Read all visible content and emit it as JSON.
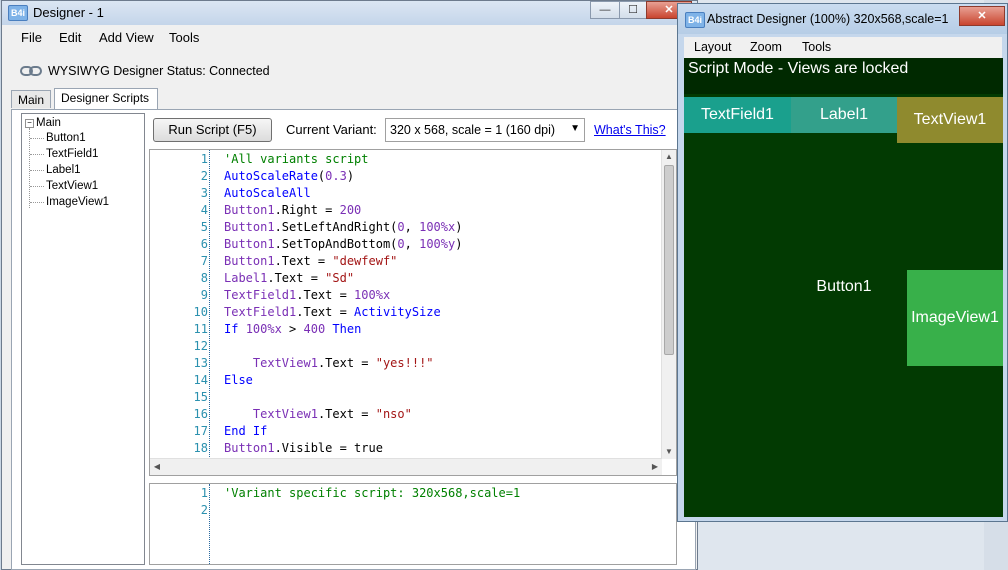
{
  "designer": {
    "title": "Designer - 1",
    "icon_text": "B4i",
    "window_buttons": [
      "—",
      "☐",
      "✕"
    ],
    "menu": [
      {
        "label": "File",
        "accel": "F"
      },
      {
        "label": "Edit",
        "accel": "E"
      },
      {
        "label": "Add View",
        "accel": "A"
      },
      {
        "label": "Tools",
        "accel": "T"
      }
    ],
    "status": "WYSIWYG Designer Status: Connected",
    "status_icon": "link-icon",
    "tabs": [
      "Main",
      "Designer Scripts"
    ],
    "active_tab": "Designer Scripts",
    "tree": {
      "root": "Main",
      "children": [
        "Button1",
        "TextField1",
        "Label1",
        "TextView1",
        "ImageView1"
      ]
    },
    "run_button": "Run Script  (F5)",
    "variant_label": "Current Variant:",
    "variant_value": "320 x 568, scale = 1 (160 dpi)",
    "whats_this": "What's This?",
    "general_script": [
      {
        "n": "1",
        "text": "'All variants script"
      },
      {
        "n": "2",
        "text": "AutoScaleRate(0.3)"
      },
      {
        "n": "3",
        "text": "AutoScaleAll"
      },
      {
        "n": "4",
        "text": "Button1.Right = 200"
      },
      {
        "n": "5",
        "text": "Button1.SetLeftAndRight(0, 100%x)"
      },
      {
        "n": "6",
        "text": "Button1.SetTopAndBottom(0, 100%y)"
      },
      {
        "n": "7",
        "text": "Button1.Text = \"dewfewf\""
      },
      {
        "n": "8",
        "text": "Label1.Text = \"Sd\""
      },
      {
        "n": "9",
        "text": "TextField1.Text = 100%x"
      },
      {
        "n": "10",
        "text": "TextField1.Text = ActivitySize"
      },
      {
        "n": "11",
        "text": "If 100%x > 400 Then"
      },
      {
        "n": "12",
        "text": ""
      },
      {
        "n": "13",
        "text": "    TextView1.Text = \"yes!!!\""
      },
      {
        "n": "14",
        "text": "Else"
      },
      {
        "n": "15",
        "text": ""
      },
      {
        "n": "16",
        "text": "    TextView1.Text = \"nso\""
      },
      {
        "n": "17",
        "text": "End If"
      },
      {
        "n": "18",
        "text": "Button1.Visible = true"
      }
    ],
    "variant_script": [
      {
        "n": "1",
        "text": "'Variant specific script: 320x568,scale=1"
      },
      {
        "n": "2",
        "text": ""
      }
    ]
  },
  "abstract": {
    "title": "Abstract Designer (100%) 320x568,scale=1",
    "icon_text": "B4i",
    "close_symbol": "✕",
    "menu": [
      {
        "label": "Layout",
        "accel": "L"
      },
      {
        "label": "Zoom",
        "accel": "Z"
      },
      {
        "label": "Tools",
        "accel": "T"
      }
    ],
    "script_mode": "Script Mode - Views are locked",
    "views": {
      "textfield": "TextField1",
      "label": "Label1",
      "textview": "TextView1",
      "button": "Button1",
      "imageview": "ImageView1"
    }
  },
  "colors": {
    "canvas_bg": "#023a02",
    "script_bar": "#002900",
    "textfield": "#1aa08d",
    "label": "#33a08b",
    "textview": "#8f8a2e",
    "imageview": "#38b04a",
    "close_button": "#c9452f"
  }
}
